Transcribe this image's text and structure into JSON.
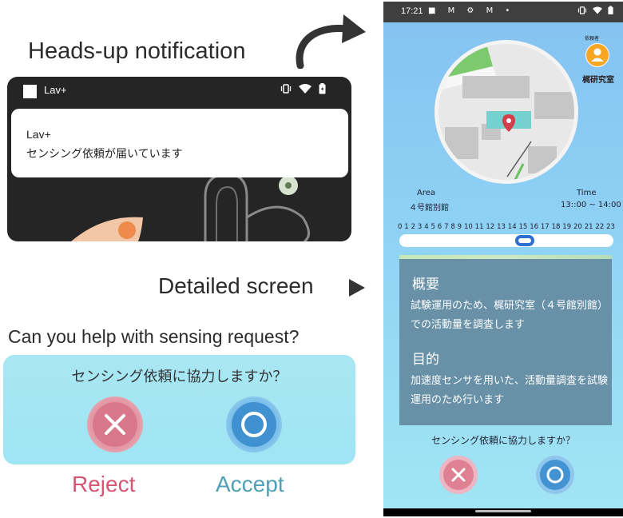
{
  "left": {
    "heads_up_title": "Heads-up notification",
    "notification": {
      "status_app": "Lav+",
      "app_name": "Lav+",
      "message": "センシング依頼が届いています"
    },
    "detailed_label": "Detailed screen",
    "help_question": "Can you help with sensing request?",
    "panel": {
      "question": "センシング依頼に協力しますか？"
    },
    "reject_label": "Reject",
    "accept_label": "Accept"
  },
  "phone": {
    "status": {
      "time": "17:21",
      "left_icons": "■ M ⚙ M •"
    },
    "requester": {
      "caption": "依頼者",
      "name": "梶研究室"
    },
    "area": {
      "label": "Area",
      "value": "４号館別館"
    },
    "time": {
      "label": "Time",
      "value": "13::00 ~ 14:00"
    },
    "hours": [
      "0",
      "1",
      "2",
      "3",
      "4",
      "5",
      "6",
      "7",
      "8",
      "9",
      "10",
      "11",
      "12",
      "13",
      "14",
      "15",
      "16",
      "17",
      "18",
      "19",
      "20",
      "21",
      "22",
      "23"
    ],
    "timeline": {
      "selected_start_hour": 13,
      "selected_end_hour": 14
    },
    "summary": {
      "title": "概要",
      "body": "試験運用のため、梶研究室（４号館別館）での活動量を調査します"
    },
    "purpose": {
      "title": "目的",
      "body": "加速度センサを用いた、活動量調査を試験運用のため行います"
    },
    "question": "センシング依頼に協力しますか？"
  },
  "colors": {
    "reject": "#d9788b",
    "accept": "#3f91d0",
    "reject_text": "#d55573",
    "accept_text": "#4fa0b5",
    "panel_bg": "#a9e6f3",
    "info_panel": "#6891a8"
  },
  "icons": {
    "heads_up_arrow": "curved-arrow-icon",
    "detail_arrow": "triangle-right-icon",
    "reject": "x-icon",
    "accept": "circle-icon",
    "map_pin": "map-pin-icon",
    "avatar": "person-icon"
  }
}
